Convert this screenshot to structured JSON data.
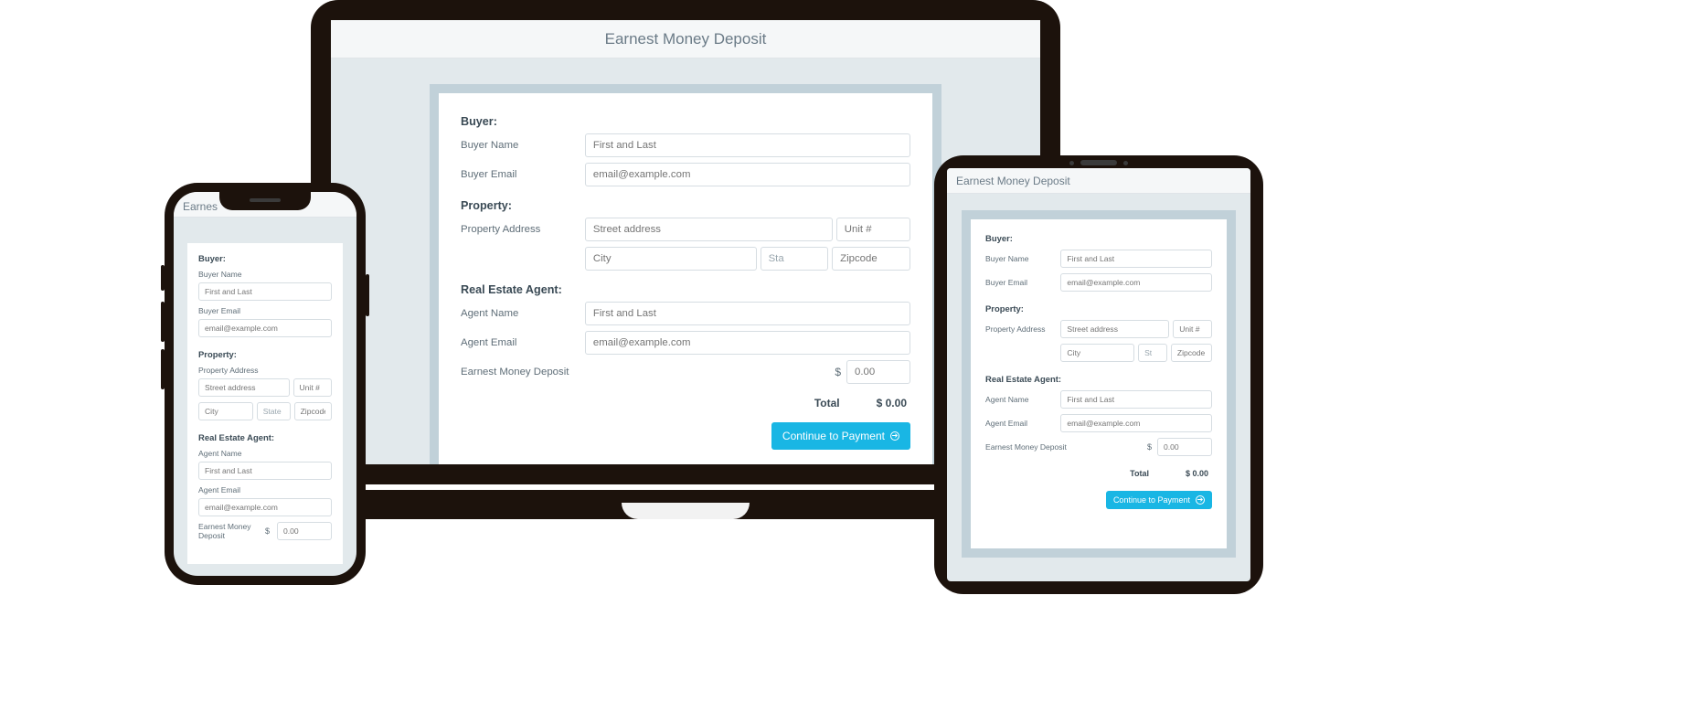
{
  "header": {
    "title": "Earnest Money Deposit",
    "title_truncated": "Earnes"
  },
  "buyer": {
    "section": "Buyer:",
    "name_label": "Buyer Name",
    "name_placeholder": "First and Last",
    "email_label": "Buyer Email",
    "email_placeholder": "email@example.com"
  },
  "property": {
    "section": "Property:",
    "address_label": "Property Address",
    "street_placeholder": "Street address",
    "unit_placeholder": "Unit #",
    "city_placeholder": "City",
    "state_placeholder": "State",
    "state_placeholder_short": "Sta",
    "state_placeholder_xs": "St",
    "zip_placeholder": "Zipcode"
  },
  "agent": {
    "section": "Real Estate Agent:",
    "name_label": "Agent Name",
    "name_placeholder": "First and Last",
    "email_label": "Agent Email",
    "email_placeholder": "email@example.com"
  },
  "deposit": {
    "label": "Earnest Money Deposit",
    "currency": "$",
    "amount_placeholder": "0.00"
  },
  "total": {
    "label": "Total",
    "value": "$ 0.00"
  },
  "cta": {
    "label": "Continue to Payment"
  }
}
